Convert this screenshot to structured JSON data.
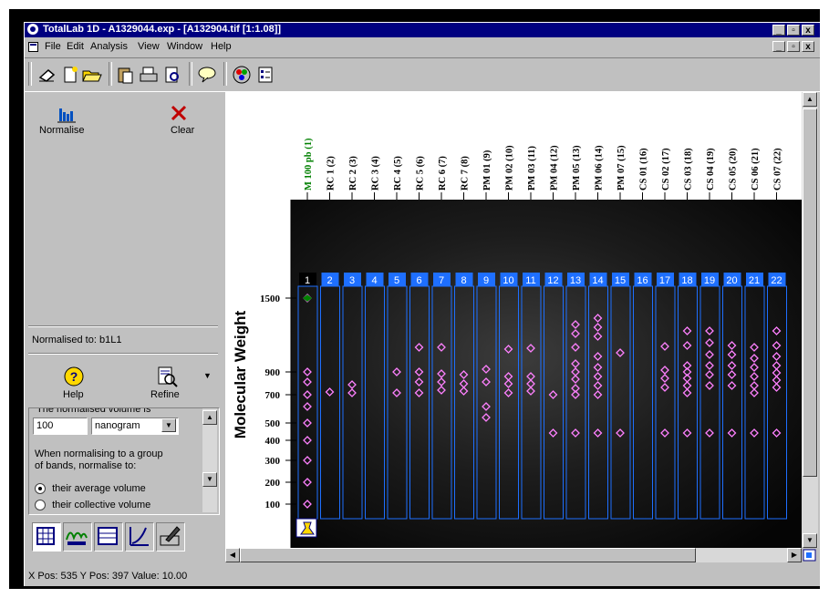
{
  "window": {
    "title": "TotalLab 1D - A1329044.exp - [A132904.tif [1:1.08]]",
    "minimize": "_",
    "maximize": "▫",
    "close": "x"
  },
  "menu": [
    "File",
    "Edit",
    "Analysis",
    "View",
    "Window",
    "Help"
  ],
  "toolbar_icons": [
    "eraser-icon",
    "new-icon",
    "open-icon",
    "paste-icon",
    "print-icon",
    "print-preview-icon",
    "comment-icon",
    "color-icon",
    "properties-icon"
  ],
  "left_panel": {
    "normalise_label": "Normalise",
    "clear_label": "Clear",
    "normalised_to": "Normalised to:  b1L1",
    "help_label": "Help",
    "refine_label": "Refine",
    "volume_caption": "The normalised volume is",
    "volume_value": "100",
    "unit_value": "nanogram",
    "group_text": "When normalising to a group of bands, normalise to:",
    "radio_average": "their average volume",
    "radio_partial": "their collective volume"
  },
  "bottom_tabs": [
    "grid-icon",
    "lanes-icon",
    "table-icon",
    "curve-icon",
    "edit-icon"
  ],
  "gel": {
    "y_axis_title": "Molecular Weight",
    "y_ticks": [
      "1500",
      "900",
      "700",
      "500",
      "400",
      "300",
      "200",
      "100"
    ],
    "lane_labels": [
      "M 100 pb (1)",
      "RC 1 (2)",
      "RC 2 (3)",
      "RC 3 (4)",
      "RC 4 (5)",
      "RC 5 (6)",
      "RC 6 (7)",
      "RC 7 (8)",
      "PM 01 (9)",
      "PM 02 (10)",
      "PM 03 (11)",
      "PM 04 (12)",
      "PM 05 (13)",
      "PM 06 (14)",
      "PM 07 (15)",
      "CS 01 (16)",
      "CS 02 (17)",
      "CS 03 (18)",
      "CS 04 (19)",
      "CS 05 (20)",
      "CS 06 (21)",
      "CS 07 (22)"
    ],
    "lane_numbers": [
      "1",
      "2",
      "3",
      "4",
      "5",
      "6",
      "7",
      "8",
      "9",
      "10",
      "11",
      "12",
      "13",
      "14",
      "15",
      "16",
      "17",
      "18",
      "19",
      "20",
      "21",
      "22"
    ],
    "marker_color": "#008000",
    "lane_box_color": "#1e6fff"
  },
  "status_bar": "X Pos: 535 Y Pos: 397 Value: 10.00"
}
